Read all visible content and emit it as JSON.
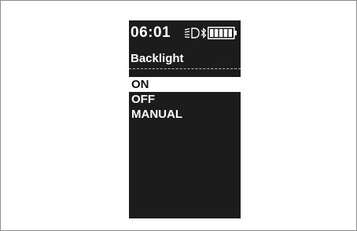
{
  "status": {
    "time": "06:01",
    "headlight_icon": "headlight-icon",
    "bluetooth_icon": "bluetooth-icon",
    "battery_icon": "battery-icon",
    "battery_level": 1.0
  },
  "screen": {
    "title": "Backlight"
  },
  "menu": {
    "items": [
      {
        "label": "ON",
        "selected": true
      },
      {
        "label": "OFF",
        "selected": false
      },
      {
        "label": "MANUAL",
        "selected": false
      }
    ]
  },
  "colors": {
    "screen_background": "#1c1c1c",
    "text": "#ffffff",
    "selection_background": "#ffffff",
    "selection_text": "#111111"
  }
}
